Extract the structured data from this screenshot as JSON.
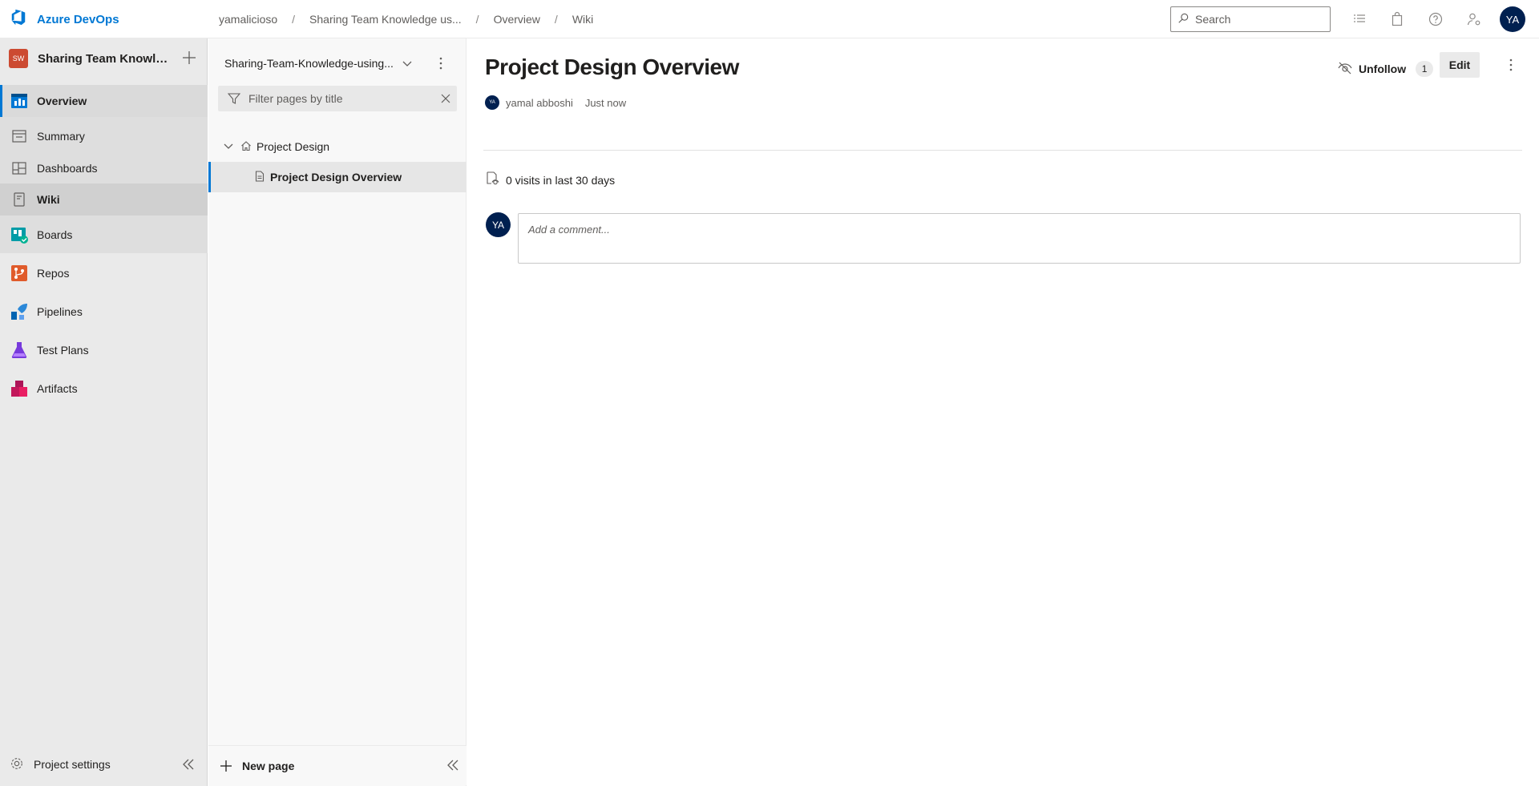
{
  "app": {
    "brand": "Azure DevOps"
  },
  "breadcrumb": [
    "yamalicioso",
    "Sharing Team Knowledge us...",
    "Overview",
    "Wiki"
  ],
  "search": {
    "placeholder": "Search"
  },
  "user": {
    "initials": "YA"
  },
  "project": {
    "badge": "SW",
    "name": "Sharing Team Knowledge using Wikis"
  },
  "nav": {
    "overview": "Overview",
    "summary": "Summary",
    "dashboards": "Dashboards",
    "wiki": "Wiki",
    "boards": "Boards",
    "repos": "Repos",
    "pipelines": "Pipelines",
    "test_plans": "Test Plans",
    "artifacts": "Artifacts",
    "settings": "Project settings"
  },
  "wiki": {
    "name": "Sharing-Team-Knowledge-using...",
    "filter_placeholder": "Filter pages by title",
    "tree": [
      {
        "label": "Project Design"
      },
      {
        "label": "Project Design Overview"
      }
    ],
    "new_page": "New page"
  },
  "page": {
    "title": "Project Design Overview",
    "author": "yamal abboshi",
    "author_initials": "YA",
    "time": "Just now",
    "follow_label": "Unfollow",
    "follow_count": "1",
    "edit_label": "Edit",
    "visits": "0 visits in last 30 days",
    "comment_placeholder": "Add a comment..."
  },
  "colors": {
    "accent": "#0078d4",
    "avatar": "#002050",
    "project_badge": "#cc4a31"
  }
}
